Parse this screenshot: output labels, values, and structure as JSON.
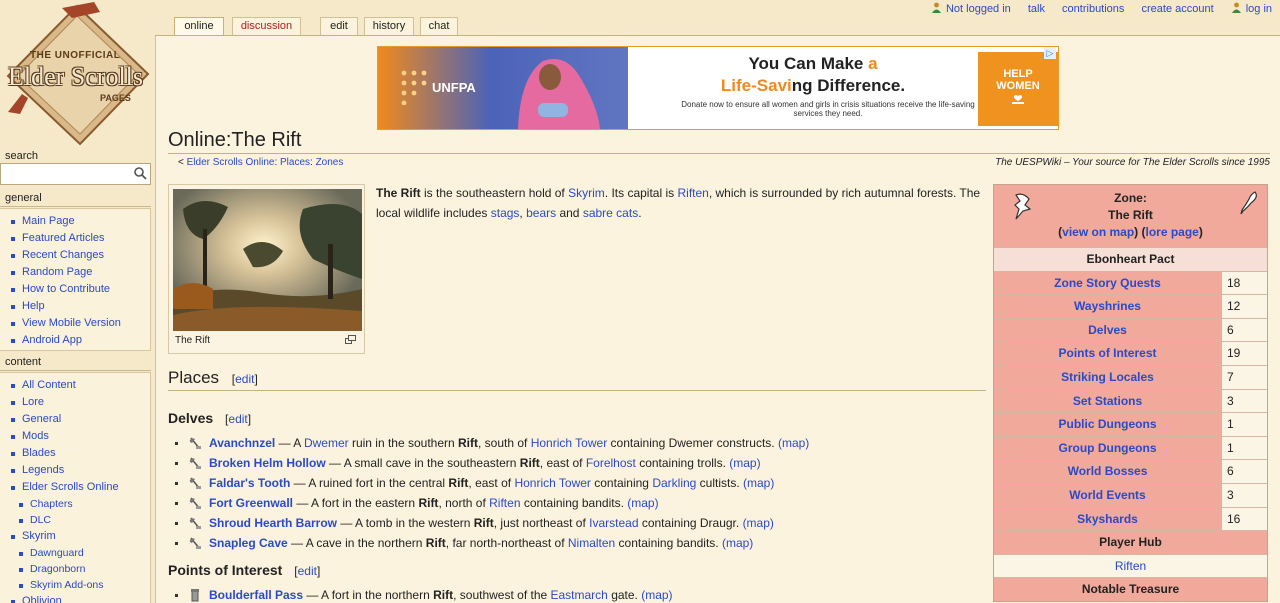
{
  "personal_tools": {
    "not_logged_in": "Not logged in",
    "talk": "talk",
    "contributions": "contributions",
    "create_account": "create account",
    "log_in": "log in"
  },
  "tabs": {
    "online": "online",
    "discussion": "discussion",
    "edit": "edit",
    "history": "history",
    "chat": "chat"
  },
  "logo": {
    "line1": "THE UNOFFICIAL",
    "line2": "Elder Scrolls",
    "line3": "PAGES"
  },
  "search": {
    "label": "search",
    "placeholder": ""
  },
  "sidebar": {
    "general_title": "general",
    "general": [
      "Main Page",
      "Featured Articles",
      "Recent Changes",
      "Random Page",
      "How to Contribute",
      "Help",
      "View Mobile Version",
      "Android App"
    ],
    "content_title": "content",
    "content": [
      "All Content",
      "Lore",
      "General",
      "Mods",
      "Blades",
      "Legends",
      "Elder Scrolls Online"
    ],
    "eso_sub": [
      "Chapters",
      "DLC"
    ],
    "skyrim": "Skyrim",
    "skyrim_sub": [
      "Dawnguard",
      "Dragonborn",
      "Skyrim Add-ons"
    ],
    "oblivion": "Oblivion"
  },
  "ad": {
    "logo": "UNFPA",
    "headline_1a": "You Can Make ",
    "headline_1b": "a",
    "headline_2a": "Life-Savi",
    "headline_2b": "ng Difference.",
    "subtext": "Donate now to ensure all women and girls in crisis situations receive the life-saving services they need.",
    "cta": "HELP WOMEN",
    "choices": "▷"
  },
  "page": {
    "title": "Online:The Rift",
    "breadcrumb_prefix": "< ",
    "breadcrumb_1": "Elder Scrolls Online",
    "breadcrumb_sep1": ": ",
    "breadcrumb_2": "Places",
    "breadcrumb_sep2": ": ",
    "breadcrumb_3": "Zones",
    "tagline": "The UESPWiki – Your source for The Elder Scrolls since 1995",
    "thumb_caption": "The Rift"
  },
  "intro": {
    "t1": "The Rift",
    "t2": " is the southeastern hold of ",
    "skyrim": "Skyrim",
    "t3": ". Its capital is ",
    "riften": "Riften",
    "t4": ", which is surrounded by ",
    "rich": "rich",
    "t5": " autumnal forests. The local wildlife includes ",
    "stags": "stags",
    "t6": ", ",
    "bears": "bears",
    "t7": " and ",
    "sabre": "sabre cats",
    "t8": "."
  },
  "sections": {
    "places": "Places",
    "delves": "Delves",
    "poi": "Points of Interest",
    "edit": "[edit]",
    "edit_open": "[",
    "edit_word": "edit",
    "edit_close": "]"
  },
  "delves": [
    {
      "name": "Avanchnzel",
      "a": " — A ",
      "l1": "Dwemer",
      "b": " ruin in the southern ",
      "r": "Rift",
      "c": ", south of ",
      "l2": "Honrich Tower",
      "d": " containing Dwemer constructs. ",
      "map": "(map)"
    },
    {
      "name": "Broken Helm Hollow",
      "a": " — A small cave in the southeastern ",
      "l1": "",
      "b": "",
      "r": "Rift",
      "c": ", east of ",
      "l2": "Forelhost",
      "d": " containing trolls. ",
      "map": "(map)"
    },
    {
      "name": "Faldar's Tooth",
      "a": " — A ruined fort in the central ",
      "l1": "",
      "b": "",
      "r": "Rift",
      "c": ", east of ",
      "l2": "Honrich Tower",
      "d": " containing ",
      "l3": "Darkling",
      "e": " cultists. ",
      "map": "(map)"
    },
    {
      "name": "Fort Greenwall",
      "a": " — A fort in the eastern ",
      "l1": "",
      "b": "",
      "r": "Rift",
      "c": ", north of ",
      "l2": "Riften",
      "d": " containing bandits. ",
      "map": "(map)"
    },
    {
      "name": "Shroud Hearth Barrow",
      "a": " — A tomb in the western ",
      "l1": "",
      "b": "",
      "r": "Rift",
      "c": ", just northeast of ",
      "l2": "Ivarstead",
      "d": " containing Draugr. ",
      "map": "(map)"
    },
    {
      "name": "Snapleg Cave",
      "a": " — A cave in the northern ",
      "l1": "",
      "b": "",
      "r": "Rift",
      "c": ", far north-northeast of ",
      "l2": "Nimalten",
      "d": " containing bandits. ",
      "map": "(map)"
    }
  ],
  "poi": [
    {
      "name": "Boulderfall Pass",
      "a": " — A fort in the northern ",
      "r": "Rift",
      "c": ", southwest of the ",
      "l2": "Eastmarch",
      "d": " gate. ",
      "map": "(map)"
    }
  ],
  "infobox": {
    "zone_label": "Zone:",
    "zone_name": "The Rift",
    "view_on_map": "view on map",
    "lore_page": "lore page",
    "lp": "(",
    "mid": ") (",
    "rp": ")",
    "faction": "Ebonheart Pact",
    "rows": [
      {
        "label": "Zone Story Quests",
        "value": "18"
      },
      {
        "label": "Wayshrines",
        "value": "12"
      },
      {
        "label": "Delves",
        "value": "6"
      },
      {
        "label": "Points of Interest",
        "value": "19"
      },
      {
        "label": "Striking Locales",
        "value": "7"
      },
      {
        "label": "Set Stations",
        "value": "3"
      },
      {
        "label": "Public Dungeons",
        "value": "1"
      },
      {
        "label": "Group Dungeons",
        "value": "1"
      },
      {
        "label": "World Bosses",
        "value": "6"
      },
      {
        "label": "World Events",
        "value": "3"
      },
      {
        "label": "Skyshards",
        "value": "16"
      }
    ],
    "player_hub_label": "Player Hub",
    "player_hub_value": "Riften",
    "notable_treasure_label": "Notable Treasure"
  },
  "colors": {
    "link": "#2a4ac8",
    "page_bg": "#f5e9c9",
    "infobox_header": "#f0a99a",
    "ad_border": "#e69a2a"
  }
}
